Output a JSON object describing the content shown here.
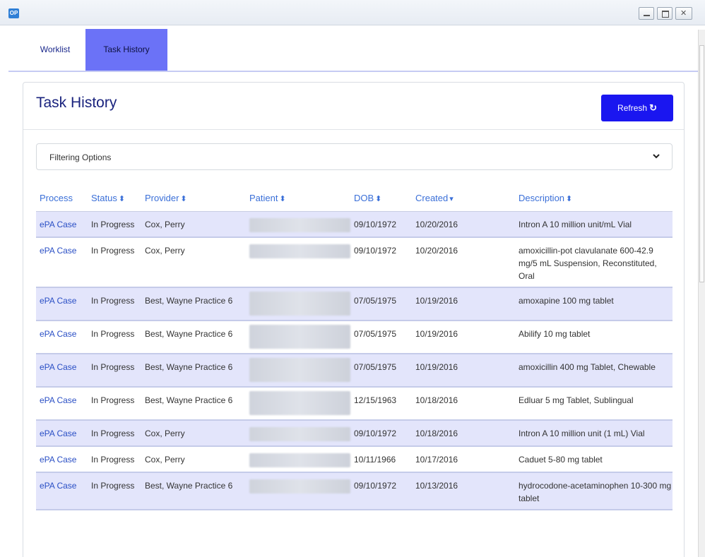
{
  "window": {
    "logo_text": "OP"
  },
  "tabs": [
    {
      "label": "Worklist"
    },
    {
      "label": "Task History"
    }
  ],
  "panel": {
    "title": "Task History",
    "refresh_label": "Refresh",
    "refresh_icon": "refresh-icon",
    "filter_label": "Filtering Options"
  },
  "table": {
    "headers": [
      {
        "label": "Process",
        "sort": ""
      },
      {
        "label": "Status",
        "sort": "⬍"
      },
      {
        "label": "Provider",
        "sort": "⬍"
      },
      {
        "label": "Patient",
        "sort": "⬍"
      },
      {
        "label": "DOB",
        "sort": "⬍"
      },
      {
        "label": "Created",
        "sort": "▾"
      },
      {
        "label": "Description",
        "sort": "⬍"
      }
    ],
    "rows": [
      {
        "process": "ePA Case",
        "status": "In Progress",
        "provider": "Cox, Perry",
        "dob": "09/10/1972",
        "created": "10/20/2016",
        "description": "Intron A 10 million unit/mL Vial"
      },
      {
        "process": "ePA Case",
        "status": "In Progress",
        "provider": "Cox, Perry",
        "dob": "09/10/1972",
        "created": "10/20/2016",
        "description": "amoxicillin-pot clavulanate 600-42.9 mg/5 mL Suspension, Reconstituted, Oral"
      },
      {
        "process": "ePA Case",
        "status": "In Progress",
        "provider": "Best, Wayne Practice 6",
        "dob": "07/05/1975",
        "created": "10/19/2016",
        "description": "amoxapine 100 mg tablet"
      },
      {
        "process": "ePA Case",
        "status": "In Progress",
        "provider": "Best, Wayne Practice 6",
        "dob": "07/05/1975",
        "created": "10/19/2016",
        "description": "Abilify 10 mg tablet"
      },
      {
        "process": "ePA Case",
        "status": "In Progress",
        "provider": "Best, Wayne Practice 6",
        "dob": "07/05/1975",
        "created": "10/19/2016",
        "description": "amoxicillin 400 mg Tablet, Chewable"
      },
      {
        "process": "ePA Case",
        "status": "In Progress",
        "provider": "Best, Wayne Practice 6",
        "dob": "12/15/1963",
        "created": "10/18/2016",
        "description": "Edluar 5 mg Tablet, Sublingual"
      },
      {
        "process": "ePA Case",
        "status": "In Progress",
        "provider": "Cox, Perry",
        "dob": "09/10/1972",
        "created": "10/18/2016",
        "description": "Intron A 10 million unit (1 mL) Vial"
      },
      {
        "process": "ePA Case",
        "status": "In Progress",
        "provider": "Cox, Perry",
        "dob": "10/11/1966",
        "created": "10/17/2016",
        "description": "Caduet 5-80 mg tablet"
      },
      {
        "process": "ePA Case",
        "status": "In Progress",
        "provider": "Best, Wayne Practice 6",
        "dob": "09/10/1972",
        "created": "10/13/2016",
        "description": "hydrocodone-acetaminophen 10-300 mg tablet"
      }
    ]
  }
}
